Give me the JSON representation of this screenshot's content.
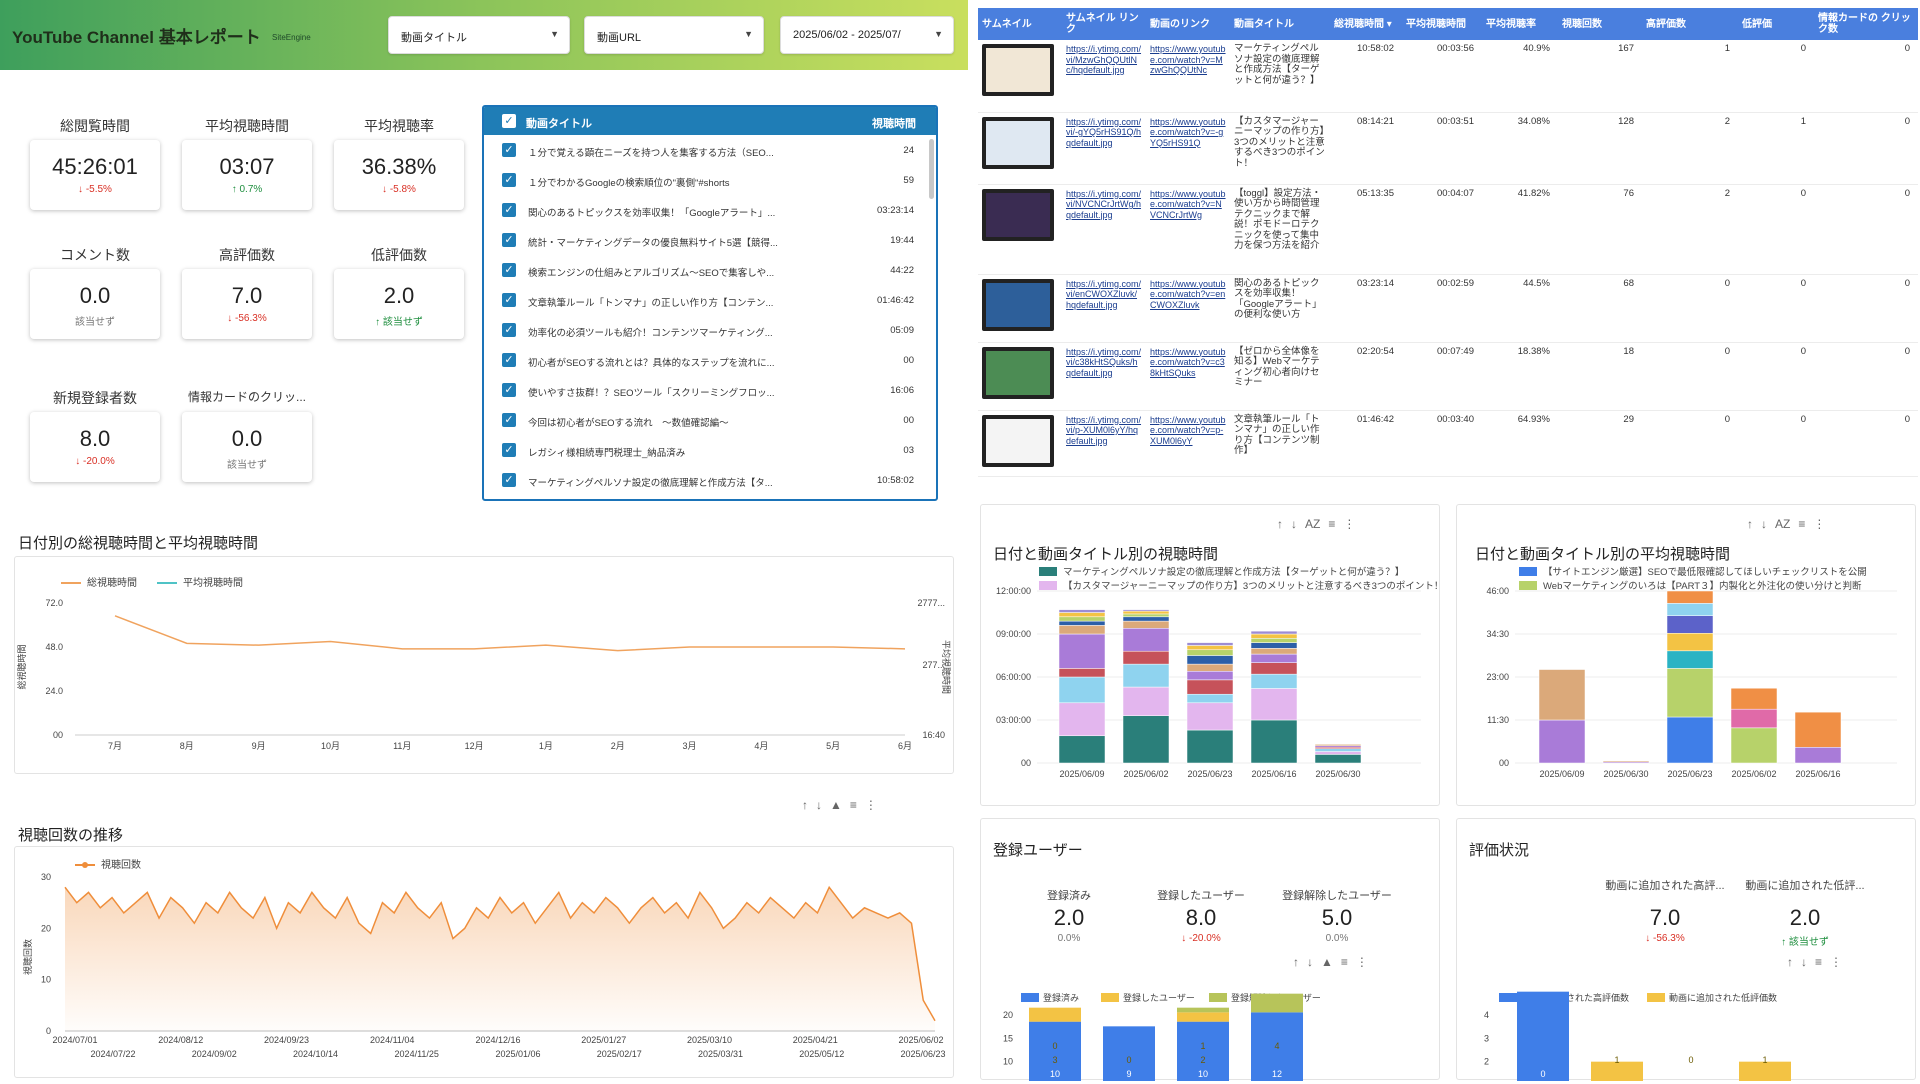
{
  "header": {
    "title": "YouTube Channel 基本レポート",
    "brand": "SiteEngine",
    "filters": [
      {
        "label": "動画タイトル"
      },
      {
        "label": "動画URL"
      },
      {
        "label": "2025/06/02 - 2025/07/"
      }
    ]
  },
  "kpis": [
    {
      "label": "総閲覧時間",
      "value": "45:26:01",
      "delta": "↓ -5.5%",
      "dir": "neg"
    },
    {
      "label": "平均視聴時間",
      "value": "03:07",
      "delta": "↑ 0.7%",
      "dir": "pos"
    },
    {
      "label": "平均視聴率",
      "value": "36.38%",
      "delta": "↓ -5.8%",
      "dir": "neg"
    },
    {
      "label": "コメント数",
      "value": "0.0",
      "delta": "該当せず",
      "dir": "neu"
    },
    {
      "label": "高評価数",
      "value": "7.0",
      "delta": "↓ -56.3%",
      "dir": "neg"
    },
    {
      "label": "低評価数",
      "value": "2.0",
      "delta": "↑ 該当せず",
      "dir": "pos"
    },
    {
      "label": "新規登録者数",
      "value": "8.0",
      "delta": "↓ -20.0%",
      "dir": "neg"
    },
    {
      "label": "情報カードのクリッ...",
      "value": "0.0",
      "delta": "該当せず",
      "dir": "neu"
    }
  ],
  "video_list": {
    "header_title": "動画タイトル",
    "header_value": "視聴時間",
    "rows": [
      {
        "title": "１分で覚える顕在ニーズを持つ人を集客する方法（SEO...",
        "value": "24"
      },
      {
        "title": "１分でわかるGoogleの検索順位の\"裏側\"#shorts",
        "value": "59"
      },
      {
        "title": "関心のあるトピックスを効率収集！「Googleアラート」...",
        "value": "03:23:14"
      },
      {
        "title": "統計・マーケティングデータの優良無料サイト5選【競得...",
        "value": "19:44"
      },
      {
        "title": "検索エンジンの仕組みとアルゴリズム〜SEOで集客しや...",
        "value": "44:22"
      },
      {
        "title": "文章執筆ルール「トンマナ」の正しい作り方【コンテン...",
        "value": "01:46:42"
      },
      {
        "title": "効率化の必須ツールも紹介！コンテンツマーケティング...",
        "value": "05:09"
      },
      {
        "title": "初心者がSEOする流れとは？具体的なステップを流れに...",
        "value": "00"
      },
      {
        "title": "使いやすさ抜群！？SEOツール「スクリーミングフロッ...",
        "value": "16:06"
      },
      {
        "title": "今回は初心者がSEOする流れ　〜数値確認編〜",
        "value": "00"
      },
      {
        "title": "レガシィ様相続専門税理士_納品済み",
        "value": "03"
      },
      {
        "title": "マーケティングペルソナ設定の徹底理解と作成方法【タ...",
        "value": "10:58:02"
      }
    ]
  },
  "table": {
    "headers": [
      "サムネイル",
      "サムネイル リンク",
      "動画のリンク",
      "動画タイトル",
      "総視聴時間 ▾",
      "平均視聴時間",
      "平均視聴率",
      "視聴回数",
      "高評価数",
      "低評価",
      "情報カードの クリック数"
    ],
    "rows": [
      {
        "thumb": "#f1e7d6",
        "thumb_link": "https://i.ytimg.com/vi/MzwGhQQUtlNc/hqdefault.jpg",
        "video_link": "https://www.youtube.com/watch?v=MzwGhQQUtNc",
        "title": "マーケティングペルソナ設定の徹底理解と作成方法【ターゲットと何が違う？】",
        "total": "10:58:02",
        "avg": "00:03:56",
        "rate": "40.9%",
        "views": "167",
        "likes": "1",
        "dislikes": "0",
        "cards": "0"
      },
      {
        "thumb": "#dfe8f2",
        "thumb_link": "https://i.ytimg.com/vi/-gYQ5rHS91Q/hqdefault.jpg",
        "video_link": "https://www.youtube.com/watch?v=-gYQ5rHS91Q",
        "title": "【カスタマージャーニーマップの作り方】3つのメリットと注意するべき3つのポイント！",
        "total": "08:14:21",
        "avg": "00:03:51",
        "rate": "34.08%",
        "views": "128",
        "likes": "2",
        "dislikes": "1",
        "cards": "0"
      },
      {
        "thumb": "#3a2c52",
        "thumb_link": "https://i.ytimg.com/vi/NVCNCrJrtWg/hqdefault.jpg",
        "video_link": "https://www.youtube.com/watch?v=NVCNCrJrtWg",
        "title": "【toggl】設定方法・使い方から時間管理テクニックまで解説！ポモドーロテクニックを使って集中力を保つ方法を紹介",
        "total": "05:13:35",
        "avg": "00:04:07",
        "rate": "41.82%",
        "views": "76",
        "likes": "2",
        "dislikes": "0",
        "cards": "0"
      },
      {
        "thumb": "#2d5f9a",
        "thumb_link": "https://i.ytimg.com/vi/enCWOXZluvk/hqdefault.jpg",
        "video_link": "https://www.youtube.com/watch?v=enCWOXZluvk",
        "title": "関心のあるトピックスを効率収集！「Googleアラート」の便利な使い方",
        "total": "03:23:14",
        "avg": "00:02:59",
        "rate": "44.5%",
        "views": "68",
        "likes": "0",
        "dislikes": "0",
        "cards": "0"
      },
      {
        "thumb": "#4c8c54",
        "thumb_link": "https://i.ytimg.com/vi/c38kHtSQuks/hqdefault.jpg",
        "video_link": "https://www.youtube.com/watch?v=c38kHtSQuks",
        "title": "【ゼロから全体像を知る】Webマーケティング初心者向けセミナー",
        "total": "02:20:54",
        "avg": "00:07:49",
        "rate": "18.38%",
        "views": "18",
        "likes": "0",
        "dislikes": "0",
        "cards": "0"
      },
      {
        "thumb": "#f4f4f4",
        "thumb_link": "https://i.ytimg.com/vi/p-XUM0l6yY/hqdefault.jpg",
        "video_link": "https://www.youtube.com/watch?v=p-XUM0l6yY",
        "title": "文章執筆ルール「トンマナ」の正しい作り方【コンテンツ制作】",
        "total": "01:46:42",
        "avg": "00:03:40",
        "rate": "64.93%",
        "views": "29",
        "likes": "0",
        "dislikes": "0",
        "cards": "0"
      }
    ]
  },
  "sections": {
    "watch_time_title": "日付別の総視聴時間と平均視聴時間",
    "views_title": "視聴回数の推移",
    "stack1_title": "日付と動画タイトル別の視聴時間",
    "stack2_title": "日付と動画タイトル別の平均視聴時間",
    "subs_title": "登録ユーザー",
    "rating_title": "評価状況"
  },
  "subs_kpis": [
    {
      "label": "登録済み",
      "value": "2.0",
      "delta": "0.0%",
      "dir": "neu"
    },
    {
      "label": "登録したユーザー",
      "value": "8.0",
      "delta": "↓ -20.0%",
      "dir": "neg"
    },
    {
      "label": "登録解除したユーザー",
      "value": "5.0",
      "delta": "0.0%",
      "dir": "neu"
    }
  ],
  "rating_kpis": [
    {
      "label": "動画に追加された高評...",
      "value": "7.0",
      "delta": "↓ -56.3%",
      "dir": "neg"
    },
    {
      "label": "動画に追加された低評...",
      "value": "2.0",
      "delta": "↑ 該当せず",
      "dir": "pos"
    }
  ],
  "controls": {
    "sort_up": "↑",
    "sort_down": "↓",
    "sort_az": "AZ",
    "filter": "⩔",
    "more": "⋮"
  },
  "chart_data": [
    {
      "type": "line",
      "title": "日付別の総視聴時間と平均視聴時間",
      "categories": [
        "7月",
        "8月",
        "9月",
        "10月",
        "11月",
        "12月",
        "1月",
        "2月",
        "3月",
        "4月",
        "5月",
        "6月"
      ],
      "series": [
        {
          "name": "総視聴時間",
          "color": "#f0a35e",
          "values": [
            65,
            50,
            49,
            51,
            47,
            47,
            49,
            46,
            48,
            48,
            48,
            47
          ]
        },
        {
          "name": "平均視聴時間",
          "color": "#4fc3c6",
          "values": []
        }
      ],
      "ylabel": "総視聴時間",
      "y2label": "平均視聴時間",
      "yticks": [
        "72.0",
        "48.0",
        "24.0",
        "00"
      ],
      "y2ticks": [
        "2777...",
        "277...",
        "16:40"
      ],
      "ylim": [
        0,
        72
      ]
    },
    {
      "type": "area",
      "title": "視聴回数の推移",
      "series": [
        {
          "name": "視聴回数",
          "color": "#ef8e3b"
        }
      ],
      "ylabel": "視聴回数",
      "yticks": [
        "30",
        "20",
        "10",
        "0"
      ],
      "ylim": [
        0,
        30
      ],
      "xticks_top": [
        "2024/07/01",
        "2024/08/12",
        "2024/09/23",
        "2024/11/04",
        "2024/12/16",
        "2025/01/27",
        "2025/03/10",
        "2025/04/21",
        "2025/06/02"
      ],
      "xticks_bottom": [
        "2024/07/22",
        "2024/09/02",
        "2024/10/14",
        "2024/11/25",
        "2025/01/06",
        "2025/02/17",
        "2025/03/31",
        "2025/05/12",
        "2025/06/23"
      ],
      "values": [
        28,
        25,
        27,
        24,
        26,
        23,
        25,
        27,
        22,
        26,
        24,
        21,
        25,
        23,
        27,
        24,
        22,
        26,
        20,
        25,
        23,
        27,
        24,
        22,
        26,
        21,
        19,
        25,
        23,
        27,
        24,
        22,
        25,
        18,
        20,
        24,
        22,
        26,
        23,
        25,
        21,
        24,
        27,
        22,
        25,
        23,
        26,
        24,
        21,
        24,
        26,
        23,
        25,
        22,
        27,
        24,
        20,
        22,
        25,
        23,
        26,
        24,
        22,
        25,
        23,
        28,
        25,
        22,
        24,
        23,
        22,
        23,
        21,
        6,
        2
      ]
    },
    {
      "type": "bar",
      "title": "日付と動画タイトル別の視聴時間",
      "categories": [
        "2025/06/09",
        "2025/06/02",
        "2025/06/23",
        "2025/06/16",
        "2025/06/30"
      ],
      "legend": [
        "マーケティングペルソナ設定の徹底理解と作成方法【ターゲットと何が違う？】",
        "【カスタマージャーニーマップの作り方】3つのメリットと注意するべき3つのポイント！"
      ],
      "yticks": [
        "12:00:00",
        "09:00:00",
        "06:00:00",
        "03:00:00",
        "00"
      ],
      "ylim": [
        0,
        12
      ],
      "colors": [
        "#2a7f7a",
        "#e3b6ee",
        "#8fd3ef",
        "#c6525a",
        "#a97bd8",
        "#dba97a",
        "#2c5fa8",
        "#b7d26a",
        "#f3c344",
        "#9c8cd4"
      ],
      "stacks": [
        [
          1.9,
          2.3,
          1.8,
          0.6,
          2.4,
          0.6,
          0.3,
          0.3,
          0.3,
          0.2
        ],
        [
          3.3,
          2.0,
          1.6,
          0.9,
          1.6,
          0.5,
          0.3,
          0.2,
          0.2,
          0.1
        ],
        [
          2.3,
          1.9,
          0.6,
          1.0,
          0.6,
          0.5,
          0.6,
          0.4,
          0.3,
          0.2
        ],
        [
          3.0,
          2.2,
          1.0,
          0.8,
          0.6,
          0.4,
          0.4,
          0.3,
          0.3,
          0.2
        ],
        [
          0.6,
          0.2,
          0.2,
          0.1,
          0.1,
          0.1,
          0.0,
          0.0,
          0.0,
          0.0
        ]
      ]
    },
    {
      "type": "bar",
      "title": "日付と動画タイトル別の平均視聴時間",
      "categories": [
        "2025/06/09",
        "2025/06/30",
        "2025/06/23",
        "2025/06/02",
        "2025/06/16"
      ],
      "legend": [
        "【サイトエンジン厳選】SEOで最低限確認してほしいチェックリストを公開",
        "Webマーケティングのいろは【PART３】内製化と外注化の使い分けと判断"
      ],
      "yticks": [
        "46:00",
        "34:30",
        "23:00",
        "11:30",
        "00"
      ],
      "ylim": [
        0,
        46
      ],
      "colors": [
        "#3f7ee8",
        "#b7d26a",
        "#a97bd8",
        "#dba97a",
        "#2ab3c4",
        "#f3c344",
        "#5c62c9",
        "#8fd3ef",
        "#e06aa8",
        "#f08f45"
      ],
      "stacks": [
        [
          0,
          0,
          11.5,
          13.5,
          0,
          0,
          0,
          0,
          0,
          0
        ],
        [
          0,
          0,
          0.3,
          0.3,
          0,
          0,
          0,
          0,
          0,
          0
        ],
        [
          12.3,
          13.0,
          0,
          0,
          4.7,
          4.7,
          4.7,
          3.3,
          0,
          3.3
        ],
        [
          0,
          9.4,
          0,
          0,
          0,
          0,
          0,
          0,
          5.0,
          5.6
        ],
        [
          0,
          0,
          4.2,
          0,
          0,
          0,
          0,
          0,
          0,
          9.4
        ]
      ]
    },
    {
      "type": "bar",
      "title": "登録ユーザー",
      "legend": [
        "登録済み",
        "登録したユーザー",
        "登録解除したユーザー"
      ],
      "colors": [
        "#3f7ee8",
        "#f3c344",
        "#b7c45a"
      ],
      "yticks": [
        "20",
        "15",
        "10",
        "5"
      ],
      "ylim": [
        5,
        20
      ],
      "stacks": [
        [
          10,
          3,
          0
        ],
        [
          9,
          0,
          0
        ],
        [
          10,
          2,
          1
        ],
        [
          12,
          0,
          4
        ]
      ],
      "labels": [
        [
          "10",
          "3",
          "0"
        ],
        [
          "9",
          "0",
          ""
        ],
        [
          "10",
          "2",
          "1"
        ],
        [
          "12",
          "",
          "4"
        ]
      ]
    },
    {
      "type": "bar",
      "title": "評価状況",
      "legend": [
        "動画に追加された高評価数",
        "動画に追加された低評価数"
      ],
      "colors": [
        "#3f7ee8",
        "#f3c344"
      ],
      "yticks": [
        "4",
        "3",
        "2",
        "1"
      ],
      "ylim": [
        1,
        4
      ],
      "stacks": [
        [
          4,
          0
        ],
        [
          0,
          1
        ],
        [
          0.05,
          0
        ],
        [
          0,
          1
        ]
      ],
      "labels": [
        [
          "0",
          ""
        ],
        [
          "",
          "1"
        ],
        [
          "",
          "0"
        ],
        [
          "",
          "1"
        ]
      ]
    }
  ]
}
